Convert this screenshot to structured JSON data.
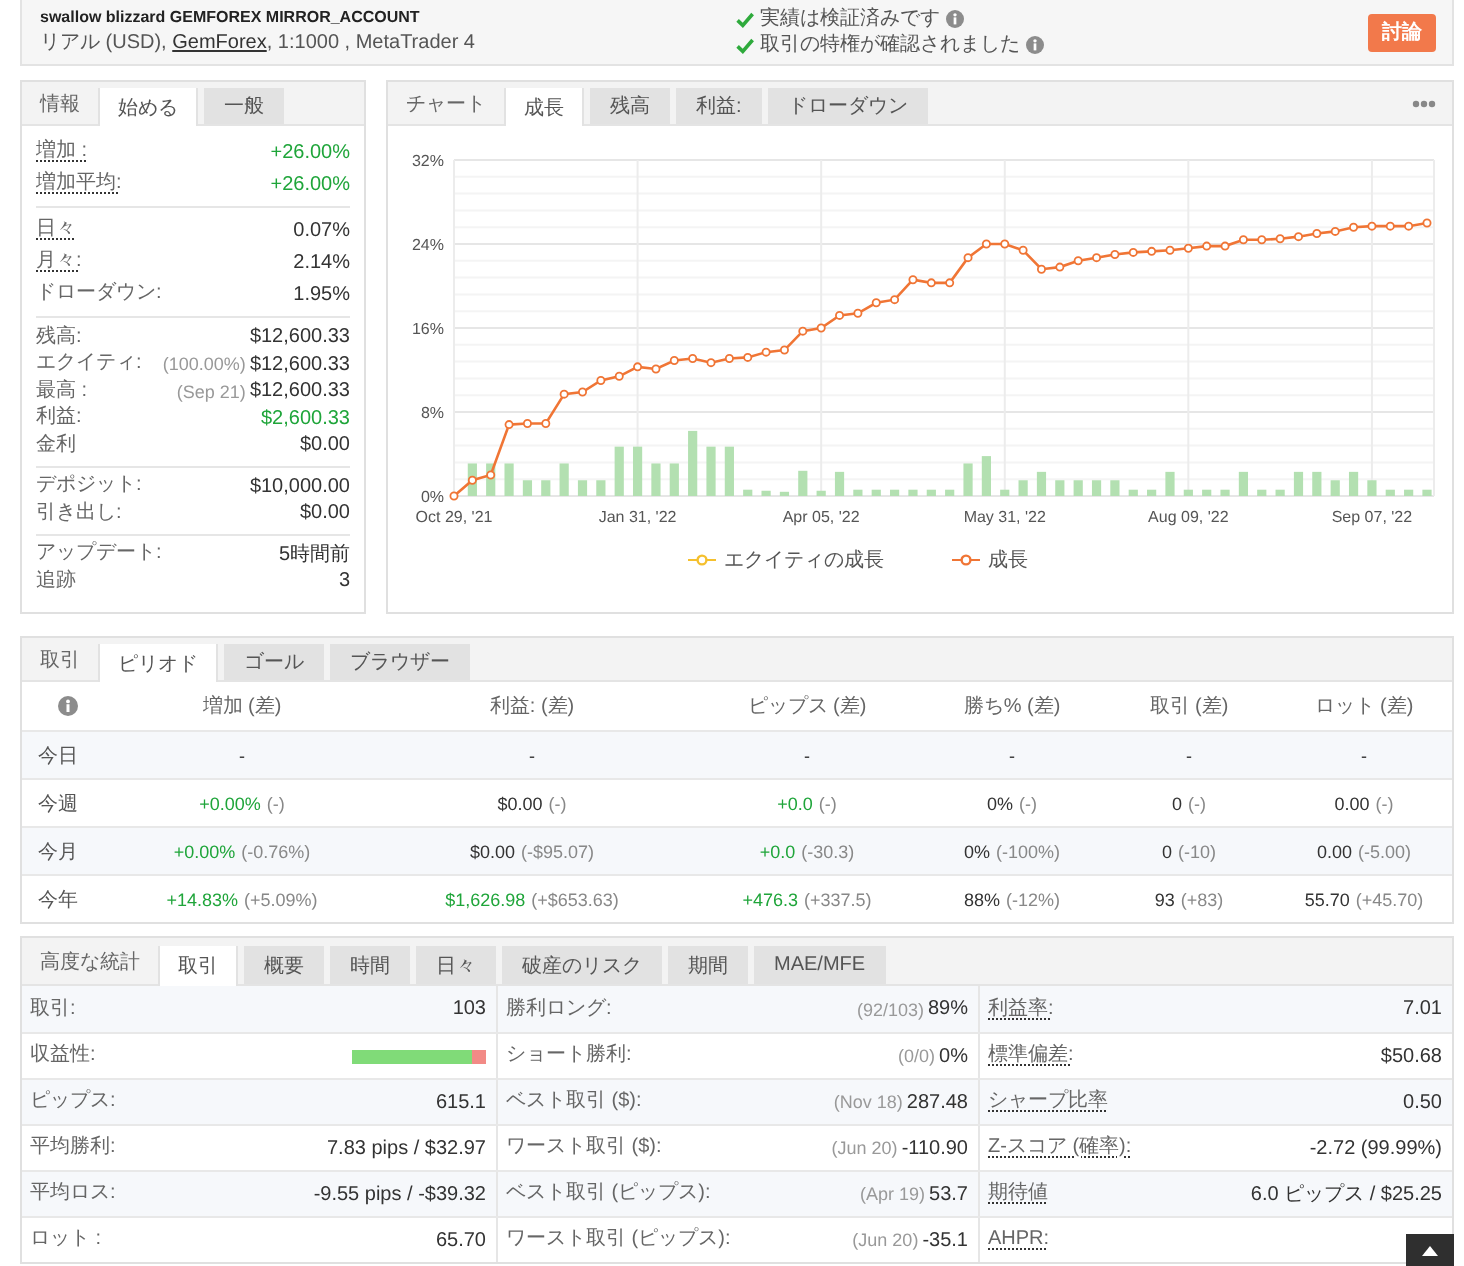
{
  "header": {
    "title": "swallow blizzard GEMFOREX MIRROR_ACCOUNT",
    "account_info": {
      "prefix": "リアル (USD),",
      "link": "GemForex",
      "suffix": ", 1:1000 , MetaTrader 4"
    },
    "verifications": [
      {
        "text": "実績は検証済みです",
        "verified": true
      },
      {
        "text": "取引の特権が確認されました",
        "verified": true
      }
    ],
    "discuss_button": "討論"
  },
  "summary": {
    "title": "情報",
    "tabs": [
      {
        "label": "始める",
        "selected": true
      },
      {
        "label": "一般",
        "selected": false
      }
    ],
    "groups": [
      {
        "rows": [
          {
            "label": "増加 :",
            "value": "+26.00%",
            "positive": true,
            "dotted": true
          },
          {
            "label": "増加平均:",
            "value": "+26.00%",
            "positive": true,
            "dotted": true
          }
        ]
      },
      {
        "rows": [
          {
            "label": "日々",
            "value": "0.07%",
            "positive": false,
            "dotted": true
          },
          {
            "label": "月々:",
            "value": "2.14%",
            "positive": false,
            "dotted": true
          },
          {
            "label": "ドローダウン:",
            "value": "1.95%",
            "positive": false,
            "dotted": false
          }
        ]
      },
      {
        "rows": [
          {
            "label": "残高:",
            "value": "$12,600.33",
            "positive": false,
            "dotted": false
          },
          {
            "label": "エクイティ:",
            "note": "(100.00%)",
            "value": "$12,600.33",
            "positive": false,
            "dotted": false
          },
          {
            "label": "最高 :",
            "note": "(Sep 21)",
            "value": "$12,600.33",
            "positive": false,
            "dotted": false
          },
          {
            "label": "利益:",
            "value": "$2,600.33",
            "positive": true,
            "dotted": false
          },
          {
            "label": "金利",
            "value": "$0.00",
            "positive": false,
            "dotted": false
          }
        ]
      },
      {
        "rows": [
          {
            "label": "デポジット:",
            "value": "$10,000.00",
            "positive": false,
            "dotted": false
          },
          {
            "label": "引き出し:",
            "value": "$0.00",
            "positive": false,
            "dotted": false
          }
        ]
      },
      {
        "rows": [
          {
            "label": "アップデート:",
            "value": "5時間前",
            "positive": false,
            "dotted": false
          },
          {
            "label": "追跡",
            "value": "3",
            "positive": false,
            "dotted": false
          }
        ]
      }
    ]
  },
  "chart": {
    "title": "チャート",
    "tabs": [
      {
        "label": "成長",
        "selected": true
      },
      {
        "label": "残高",
        "selected": false
      },
      {
        "label": "利益:",
        "selected": false
      },
      {
        "label": "ドローダウン",
        "selected": false
      }
    ],
    "legend": [
      {
        "label": "エクイティの成長",
        "color": "#f5c02e"
      }
    ],
    "chart_data": {
      "type": "line",
      "grid": true,
      "categories": [
        "Oct 29, '21",
        null,
        null,
        null,
        null,
        null,
        null,
        null,
        null,
        null,
        "Jan 31, '22",
        null,
        null,
        null,
        null,
        null,
        null,
        null,
        null,
        null,
        "Apr 05, '22",
        null,
        null,
        null,
        null,
        null,
        null,
        null,
        null,
        null,
        "May 31, '22",
        null,
        null,
        null,
        null,
        null,
        null,
        null,
        null,
        null,
        "Aug 09, '22",
        null,
        null,
        null,
        null,
        null,
        null,
        null,
        null,
        null,
        "Sep 07, '22",
        null,
        null,
        null
      ],
      "ylim": [
        0,
        32
      ],
      "yticks": [
        {
          "value": 0,
          "label": "0%"
        },
        {
          "value": 8,
          "label": "8%"
        },
        {
          "value": 16,
          "label": "16%"
        },
        {
          "value": 24,
          "label": "24%"
        },
        {
          "value": 32,
          "label": "32%"
        }
      ],
      "series": [
        {
          "name": "成長",
          "color": "#f07535",
          "marker": true,
          "values": [
            0,
            1.5,
            2.0,
            6.8,
            6.9,
            6.9,
            9.7,
            9.9,
            11.0,
            11.4,
            12.3,
            12.1,
            12.9,
            13.1,
            12.7,
            13.1,
            13.2,
            13.7,
            13.9,
            15.7,
            16.0,
            17.2,
            17.4,
            18.4,
            18.7,
            20.6,
            20.3,
            20.3,
            22.7,
            24.0,
            24.0,
            23.4,
            21.6,
            21.8,
            22.4,
            22.7,
            23.0,
            23.2,
            23.3,
            23.4,
            23.6,
            23.8,
            23.8,
            24.4,
            24.4,
            24.5,
            24.7,
            25.0,
            25.2,
            25.6,
            25.7,
            25.7,
            25.7,
            26.0
          ]
        },
        {
          "type": "bar",
          "color": "#b3e0b1",
          "values": [
            null,
            3.1,
            3.1,
            3.1,
            1.5,
            1.5,
            3.1,
            1.5,
            1.5,
            4.7,
            4.7,
            3.1,
            3.1,
            6.2,
            4.7,
            4.7,
            0.6,
            0.5,
            0.4,
            2.4,
            0.5,
            2.3,
            0.6,
            0.6,
            0.6,
            0.6,
            0.6,
            0.6,
            3.1,
            3.8,
            0.6,
            1.5,
            2.3,
            1.5,
            1.5,
            1.5,
            1.5,
            0.6,
            0.6,
            2.3,
            0.6,
            0.6,
            0.6,
            2.3,
            0.6,
            0.6,
            2.3,
            2.3,
            1.5,
            2.3,
            1.5,
            0.6,
            0.6,
            0.6
          ]
        }
      ]
    }
  },
  "periods": {
    "title": "取引",
    "tabs": [
      {
        "label": "ピリオド",
        "selected": true
      },
      {
        "label": "ゴール",
        "selected": false
      },
      {
        "label": "ブラウザー",
        "selected": false
      }
    ],
    "columns": [
      "増加 (差)",
      "利益: (差)",
      "ピップス (差)",
      "勝ち% (差)",
      "取引 (差)",
      "ロット (差)"
    ],
    "rows": [
      {
        "label": "今日",
        "cells": [
          {
            "value": "-",
            "positive": false
          },
          {
            "value": "-",
            "positive": false
          },
          {
            "value": "-",
            "positive": false
          },
          {
            "value": "-",
            "positive": false
          },
          {
            "value": "-",
            "positive": false
          },
          {
            "value": "-",
            "positive": false
          }
        ]
      },
      {
        "label": "今週",
        "cells": [
          {
            "value": "+0.00%",
            "change": "(-)",
            "positive": true
          },
          {
            "value": "$0.00",
            "change": "(-)",
            "positive": false
          },
          {
            "value": "+0.0",
            "change": "(-)",
            "positive": true
          },
          {
            "value": "0%",
            "change": "(-)",
            "positive": false
          },
          {
            "value": "0",
            "change": "(-)",
            "positive": false
          },
          {
            "value": "0.00",
            "change": "(-)",
            "positive": false
          }
        ]
      },
      {
        "label": "今月",
        "cells": [
          {
            "value": "+0.00%",
            "change": "(-0.76%)",
            "positive": true
          },
          {
            "value": "$0.00",
            "change": "(-$95.07)",
            "positive": false
          },
          {
            "value": "+0.0",
            "change": "(-30.3)",
            "positive": true
          },
          {
            "value": "0%",
            "change": "(-100%)",
            "positive": false
          },
          {
            "value": "0",
            "change": "(-10)",
            "positive": false
          },
          {
            "value": "0.00",
            "change": "(-5.00)",
            "positive": false
          }
        ]
      },
      {
        "label": "今年",
        "cells": [
          {
            "value": "+14.83%",
            "change": "(+5.09%)",
            "positive": true
          },
          {
            "value": "$1,626.98",
            "change": "(+$653.63)",
            "positive": true
          },
          {
            "value": "+476.3",
            "change": "(+337.5)",
            "positive": true
          },
          {
            "value": "88%",
            "change": "(-12%)",
            "positive": false
          },
          {
            "value": "93",
            "change": "(+83)",
            "positive": false
          },
          {
            "value": "55.70",
            "change": "(+45.70)",
            "positive": false
          }
        ]
      }
    ]
  },
  "statistics": {
    "title": "高度な統計",
    "tabs": [
      {
        "label": "取引",
        "selected": true
      },
      {
        "label": "概要",
        "selected": false
      },
      {
        "label": "時間",
        "selected": false
      },
      {
        "label": "日々",
        "selected": false
      },
      {
        "label": "破産のリスク",
        "selected": false
      },
      {
        "label": "期間",
        "selected": false
      },
      {
        "label": "MAE/MFE",
        "selected": false
      }
    ],
    "rows": [
      {
        "cells": [
          {
            "kind": "text",
            "label": "取引:",
            "value": "103",
            "dotted": false
          },
          {
            "kind": "text",
            "label": "勝利ロング:",
            "note": "(92/103)",
            "value": "89%",
            "dotted": false
          },
          {
            "kind": "text",
            "label": "利益率:",
            "value": "7.01",
            "dotted": true
          }
        ]
      },
      {
        "cells": [
          {
            "kind": "bar",
            "label": "収益性:",
            "level": 0.89,
            "dotted": false
          },
          {
            "kind": "text",
            "label": "ショート勝利:",
            "note": "(0/0)",
            "value": "0%",
            "dotted": false
          },
          {
            "kind": "text",
            "label": "標準偏差:",
            "value": "$50.68",
            "dotted": true
          }
        ]
      },
      {
        "cells": [
          {
            "kind": "text",
            "label": "ピップス:",
            "value": "615.1",
            "dotted": false
          },
          {
            "kind": "text",
            "label": "ベスト取引 ($):",
            "note": "(Nov 18)",
            "value": "287.48",
            "dotted": false
          },
          {
            "kind": "text",
            "label": "シャープ比率",
            "value": "0.50",
            "dotted": true
          }
        ]
      },
      {
        "cells": [
          {
            "kind": "text",
            "label": "平均勝利:",
            "value": "7.83 pips / $32.97",
            "dotted": false
          },
          {
            "kind": "text",
            "label": "ワースト取引 ($):",
            "note": "(Jun 20)",
            "value": "-110.90",
            "dotted": false
          },
          {
            "kind": "text",
            "label": "Z-スコア (確率):",
            "value": "-2.72 (99.99%)",
            "dotted": true
          }
        ]
      },
      {
        "cells": [
          {
            "kind": "text",
            "label": "平均ロス:",
            "value": "-9.55 pips / -$39.32",
            "dotted": false
          },
          {
            "kind": "text",
            "label": "ベスト取引 (ピップス):",
            "note": "(Apr 19)",
            "value": "53.7",
            "dotted": false
          },
          {
            "kind": "text",
            "label": "期待値",
            "value": "6.0 ピップス / $25.25",
            "dotted": true
          }
        ]
      },
      {
        "cells": [
          {
            "kind": "text",
            "label": "ロット :",
            "value": "65.70",
            "dotted": false
          },
          {
            "kind": "text",
            "label": "ワースト取引 (ピップス):",
            "note": "(Jun 20)",
            "value": "-35.1",
            "dotted": false
          },
          {
            "kind": "text",
            "label": "AHPR:",
            "dotted": true
          }
        ]
      }
    ]
  }
}
